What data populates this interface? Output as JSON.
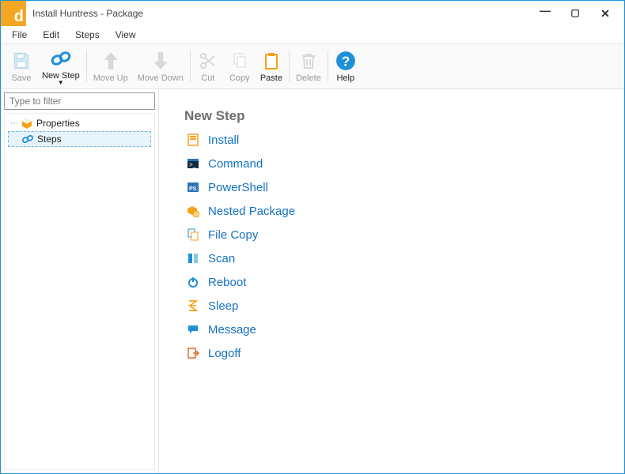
{
  "window": {
    "title": "Install Huntress - Package"
  },
  "menubar": {
    "items": [
      "File",
      "Edit",
      "Steps",
      "View"
    ]
  },
  "toolbar": {
    "save": "Save",
    "newstep": "New Step",
    "moveup": "Move Up",
    "movedown": "Move Down",
    "cut": "Cut",
    "copy": "Copy",
    "paste": "Paste",
    "delete": "Delete",
    "help": "Help"
  },
  "left": {
    "filter_placeholder": "Type to filter",
    "items": [
      {
        "label": "Properties",
        "selected": false
      },
      {
        "label": "Steps",
        "selected": true
      }
    ]
  },
  "main": {
    "heading": "New Step",
    "steps": [
      {
        "label": "Install"
      },
      {
        "label": "Command"
      },
      {
        "label": "PowerShell"
      },
      {
        "label": "Nested Package"
      },
      {
        "label": "File Copy"
      },
      {
        "label": "Scan"
      },
      {
        "label": "Reboot"
      },
      {
        "label": "Sleep"
      },
      {
        "label": "Message"
      },
      {
        "label": "Logoff"
      }
    ]
  }
}
